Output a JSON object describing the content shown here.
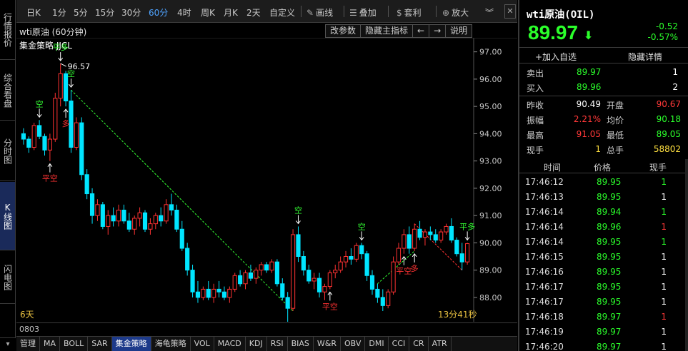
{
  "left_tabs": [
    "行情报价",
    "综合看盘",
    "分时图",
    "K线图",
    "闪电图"
  ],
  "active_left_tab": "K线图",
  "toolbar": {
    "periods": [
      "日K",
      "1分",
      "5分",
      "15分",
      "30分",
      "60分",
      "4时",
      "周K",
      "月K",
      "2天",
      "自定义"
    ],
    "active_period": "60分",
    "draw_label": "画线",
    "overlay_label": "叠加",
    "arbitrage_label": "套利",
    "zoom_label": "放大"
  },
  "chart_header": {
    "title": "wti原油 (60分钟)",
    "tools": [
      "改参数",
      "隐藏主指标",
      "←",
      "→",
      "说明"
    ],
    "strategy_label": "集金策略  JJCL"
  },
  "footer": {
    "scale_days": "6天",
    "countdown": "13分41秒",
    "date_label": "0803"
  },
  "bottom_tabs": [
    "管理",
    "MA",
    "BOLL",
    "SAR",
    "集金策略",
    "海龟策略",
    "VOL",
    "MACD",
    "KDJ",
    "RSI",
    "BIAS",
    "W&R",
    "OBV",
    "DMI",
    "CCI",
    "CR",
    "ATR"
  ],
  "active_bottom_tab": "集金策略",
  "quote": {
    "name": "wti原油(OIL)",
    "price": "89.97",
    "change": "-0.52",
    "change_pct": "-0.57%",
    "add_watch": "+加入自选",
    "hide_detail": "隐藏详情",
    "sell_label": "卖出",
    "sell_price": "89.97",
    "sell_vol": "1",
    "buy_label": "买入",
    "buy_price": "89.96",
    "buy_vol": "2",
    "prev_close_label": "昨收",
    "prev_close": "90.49",
    "open_label": "开盘",
    "open": "90.67",
    "amplitude_label": "振幅",
    "amplitude": "2.21%",
    "avg_label": "均价",
    "avg": "90.18",
    "high_label": "最高",
    "high": "91.05",
    "low_label": "最低",
    "low": "89.05",
    "cur_vol_label": "现手",
    "cur_vol": "1",
    "total_vol_label": "总手",
    "total_vol": "58802"
  },
  "ticks_header": [
    "时间",
    "价格",
    "现手"
  ],
  "ticks": [
    {
      "time": "17:46:12",
      "price": "89.95",
      "vol": "1",
      "vol_color": "green"
    },
    {
      "time": "17:46:13",
      "price": "89.95",
      "vol": "1",
      "vol_color": "white"
    },
    {
      "time": "17:46:14",
      "price": "89.94",
      "vol": "1",
      "vol_color": "green"
    },
    {
      "time": "17:46:14",
      "price": "89.96",
      "vol": "1",
      "vol_color": "red"
    },
    {
      "time": "17:46:14",
      "price": "89.95",
      "vol": "1",
      "vol_color": "green"
    },
    {
      "time": "17:46:15",
      "price": "89.95",
      "vol": "1",
      "vol_color": "white"
    },
    {
      "time": "17:46:16",
      "price": "89.95",
      "vol": "1",
      "vol_color": "white"
    },
    {
      "time": "17:46:17",
      "price": "89.95",
      "vol": "1",
      "vol_color": "white"
    },
    {
      "time": "17:46:17",
      "price": "89.95",
      "vol": "1",
      "vol_color": "white"
    },
    {
      "time": "17:46:18",
      "price": "89.97",
      "vol": "1",
      "vol_color": "red"
    },
    {
      "time": "17:46:19",
      "price": "89.97",
      "vol": "1",
      "vol_color": "white"
    },
    {
      "time": "17:46:20",
      "price": "89.97",
      "vol": "1",
      "vol_color": "white"
    }
  ],
  "colors": {
    "up": "#ff3232",
    "down": "#00e5ff",
    "signal_green": "#33ff33",
    "signal_red": "#ff3232",
    "trend_up": "#33ff33",
    "trend_down": "#ff3232"
  },
  "chart_data": {
    "type": "candlestick",
    "title": "wti原油 (60分钟)",
    "ylim": [
      87.5,
      97.2
    ],
    "yticks": [
      "97.00",
      "96.00",
      "95.00",
      "94.00",
      "93.00",
      "92.00",
      "91.00",
      "90.00",
      "89.00",
      "88.00"
    ],
    "annotations": {
      "high": "96.57",
      "low": "87.02"
    },
    "candles": [
      [
        94.0,
        94.2,
        93.6,
        93.8
      ],
      [
        93.8,
        93.9,
        93.3,
        93.5
      ],
      [
        93.5,
        94.4,
        93.4,
        94.3
      ],
      [
        94.3,
        94.5,
        93.8,
        93.9
      ],
      [
        93.9,
        94.0,
        93.2,
        93.4
      ],
      [
        93.4,
        94.0,
        93.0,
        93.8
      ],
      [
        93.8,
        95.5,
        93.7,
        95.3
      ],
      [
        95.3,
        96.57,
        95.0,
        96.2
      ],
      [
        96.2,
        96.3,
        95.0,
        95.2
      ],
      [
        95.2,
        95.6,
        93.3,
        93.5
      ],
      [
        93.5,
        94.6,
        93.4,
        94.4
      ],
      [
        94.4,
        94.6,
        92.3,
        92.5
      ],
      [
        92.5,
        92.7,
        91.6,
        91.8
      ],
      [
        91.8,
        92.0,
        90.7,
        91.0
      ],
      [
        91.0,
        91.6,
        90.8,
        91.4
      ],
      [
        91.4,
        91.5,
        90.5,
        90.6
      ],
      [
        90.6,
        91.2,
        90.3,
        91.0
      ],
      [
        91.0,
        91.3,
        90.6,
        90.8
      ],
      [
        90.8,
        91.4,
        90.6,
        91.2
      ],
      [
        91.2,
        91.4,
        90.7,
        90.8
      ],
      [
        90.8,
        91.1,
        90.4,
        90.5
      ],
      [
        90.5,
        91.0,
        90.3,
        90.9
      ],
      [
        90.9,
        91.3,
        90.6,
        91.1
      ],
      [
        91.1,
        91.2,
        90.4,
        90.5
      ],
      [
        90.5,
        90.9,
        90.3,
        90.7
      ],
      [
        90.7,
        91.1,
        90.5,
        91.0
      ],
      [
        91.0,
        91.3,
        90.6,
        90.8
      ],
      [
        90.8,
        91.6,
        90.7,
        91.4
      ],
      [
        91.4,
        91.8,
        91.0,
        91.2
      ],
      [
        91.2,
        91.4,
        90.4,
        90.5
      ],
      [
        90.5,
        90.8,
        89.7,
        89.8
      ],
      [
        89.8,
        90.0,
        88.8,
        89.0
      ],
      [
        89.0,
        89.2,
        88.0,
        88.2
      ],
      [
        88.2,
        88.6,
        87.8,
        88.0
      ],
      [
        88.0,
        88.4,
        87.9,
        88.3
      ],
      [
        88.3,
        88.6,
        87.9,
        88.0
      ],
      [
        88.0,
        88.5,
        87.8,
        88.3
      ],
      [
        88.3,
        88.6,
        88.0,
        88.2
      ],
      [
        88.2,
        88.4,
        87.9,
        88.0
      ],
      [
        88.0,
        88.4,
        87.8,
        88.3
      ],
      [
        88.3,
        88.9,
        88.2,
        88.8
      ],
      [
        88.8,
        89.0,
        88.4,
        88.5
      ],
      [
        88.5,
        89.0,
        88.3,
        88.9
      ],
      [
        88.9,
        89.2,
        88.6,
        88.7
      ],
      [
        88.7,
        89.1,
        88.5,
        89.0
      ],
      [
        89.0,
        89.3,
        88.8,
        89.2
      ],
      [
        89.2,
        89.3,
        88.9,
        89.0
      ],
      [
        89.0,
        89.4,
        88.9,
        89.3
      ],
      [
        89.3,
        89.4,
        88.4,
        88.5
      ],
      [
        88.5,
        88.7,
        87.9,
        88.0
      ],
      [
        88.0,
        88.2,
        87.02,
        87.6
      ],
      [
        87.6,
        90.5,
        87.5,
        90.3
      ],
      [
        90.3,
        90.6,
        89.3,
        89.5
      ],
      [
        89.5,
        89.7,
        88.8,
        89.0
      ],
      [
        89.0,
        89.2,
        88.5,
        88.6
      ],
      [
        88.6,
        88.9,
        88.3,
        88.7
      ],
      [
        88.7,
        88.9,
        88.0,
        88.2
      ],
      [
        88.2,
        88.5,
        87.9,
        88.4
      ],
      [
        88.4,
        89.0,
        88.3,
        88.9
      ],
      [
        88.9,
        89.2,
        88.7,
        89.0
      ],
      [
        89.0,
        89.5,
        88.9,
        89.3
      ],
      [
        89.3,
        89.7,
        89.1,
        89.5
      ],
      [
        89.5,
        89.8,
        89.2,
        89.4
      ],
      [
        89.4,
        90.0,
        89.3,
        89.9
      ],
      [
        89.9,
        90.0,
        89.4,
        89.6
      ],
      [
        89.6,
        89.7,
        88.6,
        88.8
      ],
      [
        88.8,
        89.0,
        88.1,
        88.3
      ],
      [
        88.3,
        88.5,
        87.8,
        88.0
      ],
      [
        88.0,
        88.3,
        87.5,
        87.7
      ],
      [
        87.7,
        88.3,
        87.6,
        88.2
      ],
      [
        88.2,
        89.5,
        88.1,
        89.3
      ],
      [
        89.3,
        90.0,
        89.2,
        89.8
      ],
      [
        89.8,
        90.5,
        89.6,
        90.3
      ],
      [
        90.3,
        90.6,
        89.6,
        89.8
      ],
      [
        89.8,
        90.7,
        89.7,
        90.5
      ],
      [
        90.5,
        90.8,
        90.1,
        90.2
      ],
      [
        90.2,
        90.5,
        89.9,
        90.4
      ],
      [
        90.4,
        90.6,
        90.1,
        90.3
      ],
      [
        90.3,
        90.5,
        90.0,
        90.1
      ],
      [
        90.1,
        90.5,
        90.0,
        90.4
      ],
      [
        90.4,
        90.7,
        90.3,
        90.6
      ],
      [
        90.6,
        90.9,
        90.0,
        90.1
      ],
      [
        90.1,
        90.2,
        89.5,
        89.6
      ],
      [
        89.6,
        90.0,
        89.0,
        89.3
      ],
      [
        89.3,
        90.0,
        89.2,
        89.97
      ]
    ],
    "signals": [
      {
        "index": 3,
        "label": "空",
        "color": "green",
        "pos": "above"
      },
      {
        "index": 5,
        "label": "平空",
        "color": "red",
        "pos": "below"
      },
      {
        "index": 7,
        "label": "平多",
        "color": "green",
        "pos": "above"
      },
      {
        "index": 8,
        "label": "多",
        "color": "red",
        "pos": "below"
      },
      {
        "index": 9,
        "label": "空",
        "color": "green",
        "pos": "above"
      },
      {
        "index": 50,
        "label": "平空",
        "color": "red",
        "pos": "below"
      },
      {
        "index": 52,
        "label": "空",
        "color": "green",
        "pos": "above"
      },
      {
        "index": 58,
        "label": "平空",
        "color": "red",
        "pos": "below"
      },
      {
        "index": 64,
        "label": "空",
        "color": "green",
        "pos": "above"
      },
      {
        "index": 72,
        "label": "平空",
        "color": "red",
        "pos": "below"
      },
      {
        "index": 74,
        "label": "多",
        "color": "red",
        "pos": "below"
      },
      {
        "index": 84,
        "label": "平多",
        "color": "green",
        "pos": "above"
      }
    ],
    "trend_lines": [
      {
        "from": 9,
        "to": 51,
        "color": "green"
      },
      {
        "from": 67,
        "to": 74,
        "color": "green"
      },
      {
        "from": 74,
        "to": 83,
        "color": "red"
      }
    ]
  }
}
